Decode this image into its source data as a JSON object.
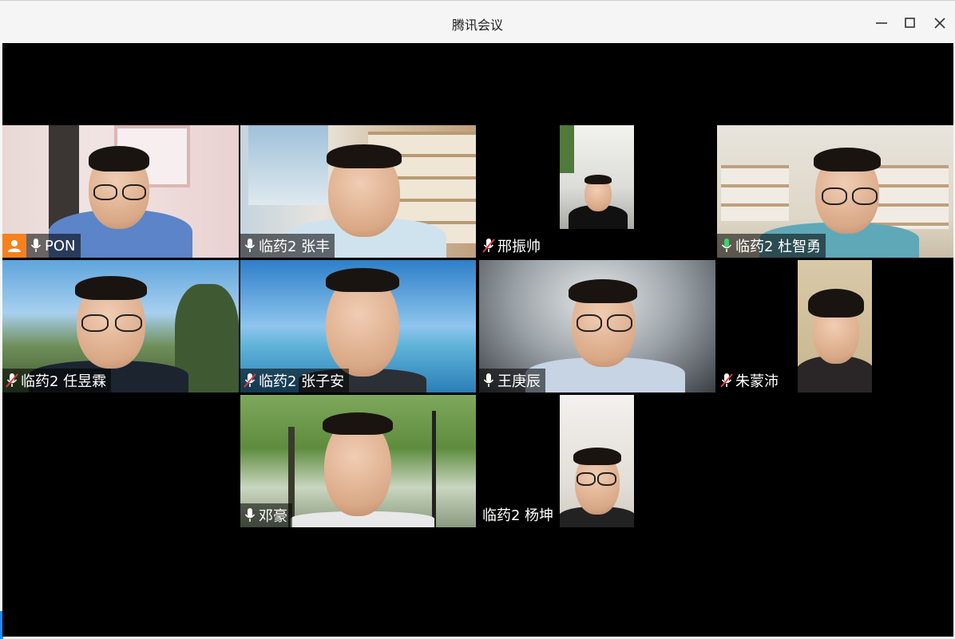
{
  "window": {
    "title": "腾讯会议"
  },
  "participants": [
    {
      "name": "PON",
      "mic": "on",
      "host": true
    },
    {
      "name": "临药2 张丰",
      "mic": "on"
    },
    {
      "name": "邢振帅",
      "mic": "muted"
    },
    {
      "name": "临药2 杜智勇",
      "mic": "speaking",
      "active": true
    },
    {
      "name": "临药2 任昱霖",
      "mic": "muted"
    },
    {
      "name": "临药2 张子安",
      "mic": "muted"
    },
    {
      "name": "王庚辰",
      "mic": "on"
    },
    {
      "name": "朱蒙沛",
      "mic": "muted"
    },
    {
      "name": "邓豪",
      "mic": "on"
    },
    {
      "name": "临药2 杨坤",
      "mic": "none"
    }
  ],
  "colors": {
    "stage": "#000000",
    "active_border": "#2fb46c",
    "speaking_mic": "#3fd36f",
    "muted_slash": "#e03a3a",
    "host_badge": "#f7821c",
    "edge_accent": "#1a8cff"
  },
  "icons": {
    "minimize": "minimize-icon",
    "maximize": "maximize-icon",
    "close": "close-icon",
    "mic": "microphone-icon",
    "mic_muted": "microphone-muted-icon",
    "host": "host-user-icon"
  }
}
